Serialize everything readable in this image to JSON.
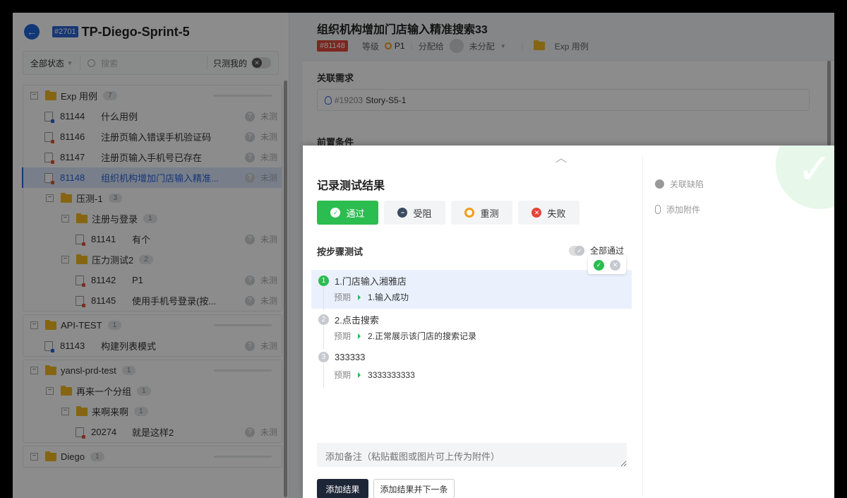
{
  "left": {
    "sprint_id": "#2701",
    "sprint_name": "TP-Diego-Sprint-5",
    "filter_status": "全部状态",
    "search_placeholder": "搜索",
    "only_mine": "只测我的"
  },
  "tree": {
    "groups": [
      {
        "name": "Exp 用例",
        "count": "7",
        "cases": [
          {
            "id": "81144",
            "name": "什么用例",
            "status": "未测"
          },
          {
            "id": "81146",
            "name": "注册页输入错误手机验证码",
            "status": "未测"
          },
          {
            "id": "81147",
            "name": "注册页输入手机号已存在",
            "status": "未测"
          },
          {
            "id": "81148",
            "name": "组织机构增加门店输入精准...",
            "status": "未测"
          }
        ],
        "sub": {
          "name": "压测-1",
          "count": "3",
          "folder1": {
            "name": "注册与登录",
            "count": "1",
            "cases": [
              {
                "id": "81141",
                "name": "有个",
                "status": "未测"
              }
            ]
          },
          "folder2": {
            "name": "压力测试2",
            "count": "2",
            "cases": [
              {
                "id": "81142",
                "name": "P1",
                "status": "未测"
              },
              {
                "id": "81145",
                "name": "使用手机号登录(按...",
                "status": "未测"
              }
            ]
          }
        }
      },
      {
        "name": "API-TEST",
        "count": "1",
        "cases": [
          {
            "id": "81143",
            "name": "构建列表模式",
            "status": "未测"
          }
        ]
      },
      {
        "name": "yansl-prd-test",
        "count": "1",
        "sub": {
          "name": "再来一个分组",
          "count": "1",
          "folder": {
            "name": "来啊来啊",
            "count": "1",
            "cases": [
              {
                "id": "20274",
                "name": "就是这样2",
                "status": "未测"
              }
            ]
          }
        }
      },
      {
        "name": "Diego",
        "count": "1"
      }
    ]
  },
  "detail": {
    "title": "组织机构增加门店输入精准搜索33",
    "case_tag": "#81148",
    "level_label": "等级",
    "level_value": "P1",
    "assign_label": "分配给",
    "assign_value": "未分配",
    "folder": "Exp 用例",
    "related_req_label": "关联需求",
    "story_id": "#19203",
    "story_name": "Story-S5-1",
    "precondition_label": "前置条件"
  },
  "modal": {
    "title": "记录测试结果",
    "results": [
      "通过",
      "受阻",
      "重测",
      "失败"
    ],
    "steps_title": "按步骤测试",
    "all_pass": "全部通过",
    "expected_label": "预期",
    "steps": [
      {
        "num": "1",
        "action": "1.门店输入湘雅店",
        "expected": "1.输入成功"
      },
      {
        "num": "2",
        "action": "2.点击搜索",
        "expected": "2.正常展示该门店的搜索记录"
      },
      {
        "num": "3",
        "action": "333333",
        "expected": "3333333333"
      }
    ],
    "note_placeholder": "添加备注（粘贴截图或图片可上传为附件）",
    "add_result": "添加结果",
    "add_result_next": "添加结果并下一条",
    "link_bug": "关联缺陷",
    "add_attachment": "添加附件"
  },
  "colors": {
    "primary": "#2a64d6",
    "pass": "#2bbd4f",
    "fail": "#e6443a",
    "retest": "#f39c12",
    "folder": "#f5b822"
  }
}
